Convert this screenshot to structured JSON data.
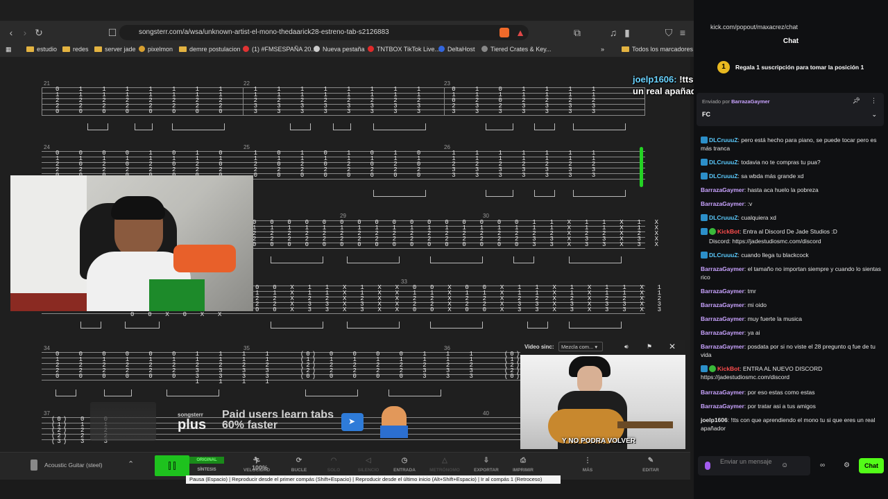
{
  "browser": {
    "url": "songsterr.com/a/wsa/unknown-artist-el-mono-thedaarick28-estreno-tab-s2126883",
    "bookmarks": [
      "estudio",
      "redes",
      "server jade",
      "pixelmon",
      "demre postulacion",
      "(1) #FMSESPAÑA 20...",
      "Nueva pestaña",
      "TNTBOX TikTok Live...",
      "DeltaHost",
      "Tiered Crates & Key..."
    ],
    "all_bookmarks": "Todos los marcadores"
  },
  "tab": {
    "bar_numbers": [
      "21",
      "22",
      "23",
      "24",
      "25",
      "26",
      "29",
      "30",
      "33",
      "34",
      "35",
      "36",
      "37",
      "40"
    ]
  },
  "video_sync": {
    "label": "Video sinc:",
    "select_value": "Mezcla com...",
    "caption": "Y NO PODRA VOLVER"
  },
  "ad": {
    "brand": "songsterr",
    "plus": "plus",
    "line1": "Paid users learn tabs",
    "line2": "60% faster"
  },
  "toolbar": {
    "instrument": "Acoustic Guitar (steel)",
    "original": "ORIGINAL",
    "sintesis": "SÍNTESIS",
    "speed_value": "100%",
    "items": [
      "VELOCIDAD",
      "BUCLE",
      "SOLO",
      "SILENCIO",
      "ENTRADA",
      "METRÓNOMO",
      "EXPORTAR",
      "IMPRIMIR",
      "MÁS",
      "EDITAR"
    ],
    "tooltip": "Pausa (Espacio) | Reproducir desde el primer compás (Shift+Espacio) | Reproducir desde el último inicio (Alt+Shift+Espacio) | Ir al compás 1 (Retroceso)"
  },
  "chat": {
    "url": "kick.com/popout/maxacrez/chat",
    "title": "Chat",
    "sub_promo": "Regala 1 suscripción para tomar la posición 1",
    "pinned_by_label": "Enviado por",
    "pinned_by_user": "BarrazaGaymer",
    "pinned_msg": "FC",
    "messages": [
      {
        "user": "DLCruuuZ",
        "text": "pero está hecho para piano, se puede tocar pero es más tranca",
        "color": "#5ac8fa"
      },
      {
        "user": "DLCruuuZ",
        "text": "todavia no te compras tu pua?",
        "color": "#5ac8fa"
      },
      {
        "user": "DLCruuuZ",
        "text": "sa wbda más grande xd",
        "color": "#5ac8fa"
      },
      {
        "user": "BarrazaGaymer",
        "text": "hasta aca huelo la pobreza",
        "color": "#c9a3ff"
      },
      {
        "user": "BarrazaGaymer",
        "text": ":v",
        "color": "#c9a3ff"
      },
      {
        "user": "DLCruuuZ",
        "text": "cualquiera xd",
        "color": "#5ac8fa"
      },
      {
        "user": "KickBot",
        "text": "Entra al Discord De Jade Studios :D",
        "color": "#ff4d4d"
      },
      {
        "user": "",
        "text": "Discord: https://jadestudiosmc.com/discord",
        "color": "#e6e6e6"
      },
      {
        "user": "DLCruuuZ",
        "text": "cuando llega tu blackcock",
        "color": "#5ac8fa"
      },
      {
        "user": "BarrazaGaymer",
        "text": "el tamaño no importan siempre y cuando lo sientas rico",
        "color": "#c9a3ff"
      },
      {
        "user": "BarrazaGaymer",
        "text": "tmr",
        "color": "#c9a3ff"
      },
      {
        "user": "BarrazaGaymer",
        "text": "mi oido",
        "color": "#c9a3ff"
      },
      {
        "user": "BarrazaGaymer",
        "text": "muy fuerte la musica",
        "color": "#c9a3ff"
      },
      {
        "user": "BarrazaGaymer",
        "text": "ya ai",
        "color": "#c9a3ff"
      },
      {
        "user": "BarrazaGaymer",
        "text": "posdata por si no viste el 28 pregunto q fue de tu vida",
        "color": "#c9a3ff"
      },
      {
        "user": "KickBot",
        "text": "ENTRA AL NUEVO DISCORD https://jadestudiosmc.com/discord",
        "color": "#ff4d4d"
      },
      {
        "user": "BarrazaGaymer",
        "text": "por eso estas como estas",
        "color": "#c9a3ff"
      },
      {
        "user": "BarrazaGaymer",
        "text": "por tratar asi a tus amigos",
        "color": "#c9a3ff"
      },
      {
        "user": "joelp1606",
        "text": "!tts con que aprendiendo el mono tu si que eres un real apañador",
        "color": "#e6e6e6"
      }
    ],
    "input_placeholder": "Enviar un mensaje",
    "send_label": "Chat"
  },
  "overlay": {
    "tts_user": "joelp1606:",
    "tts_text": "!tts con que aprendiendo el mono tu si que eres un real apañador"
  }
}
